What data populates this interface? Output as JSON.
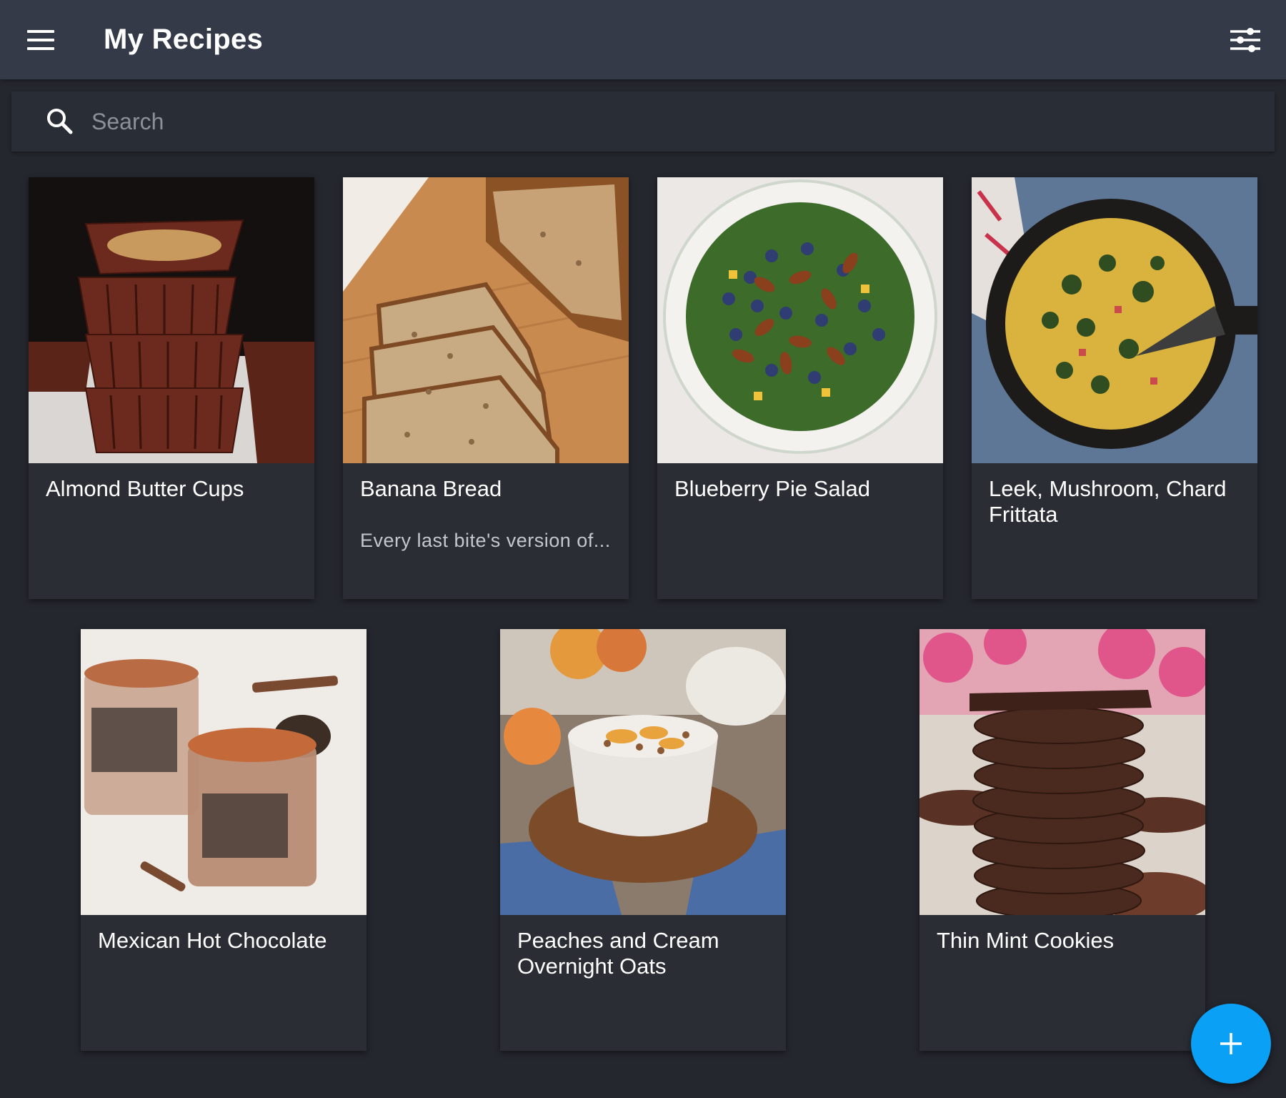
{
  "app": {
    "title": "My Recipes"
  },
  "search": {
    "placeholder": "Search",
    "value": ""
  },
  "recipes": [
    {
      "title": "Almond Butter Cups",
      "description": ""
    },
    {
      "title": "Banana Bread",
      "description": "Every last bite's version of..."
    },
    {
      "title": "Blueberry Pie Salad",
      "description": ""
    },
    {
      "title": "Leek, Mushroom, Chard Frittata",
      "description": ""
    },
    {
      "title": "Mexican Hot Chocolate",
      "description": ""
    },
    {
      "title": "Peaches and Cream Overnight Oats",
      "description": ""
    },
    {
      "title": "Thin Mint Cookies",
      "description": ""
    }
  ],
  "icons": {
    "menu": "menu-icon",
    "filter": "filter-sliders-icon",
    "search": "search-icon",
    "add": "add-icon"
  },
  "colors": {
    "app_bar": "#343a48",
    "background": "#24272e",
    "card": "#2a2d34",
    "fab": "#0aa0f5",
    "text": "#ffffff"
  }
}
